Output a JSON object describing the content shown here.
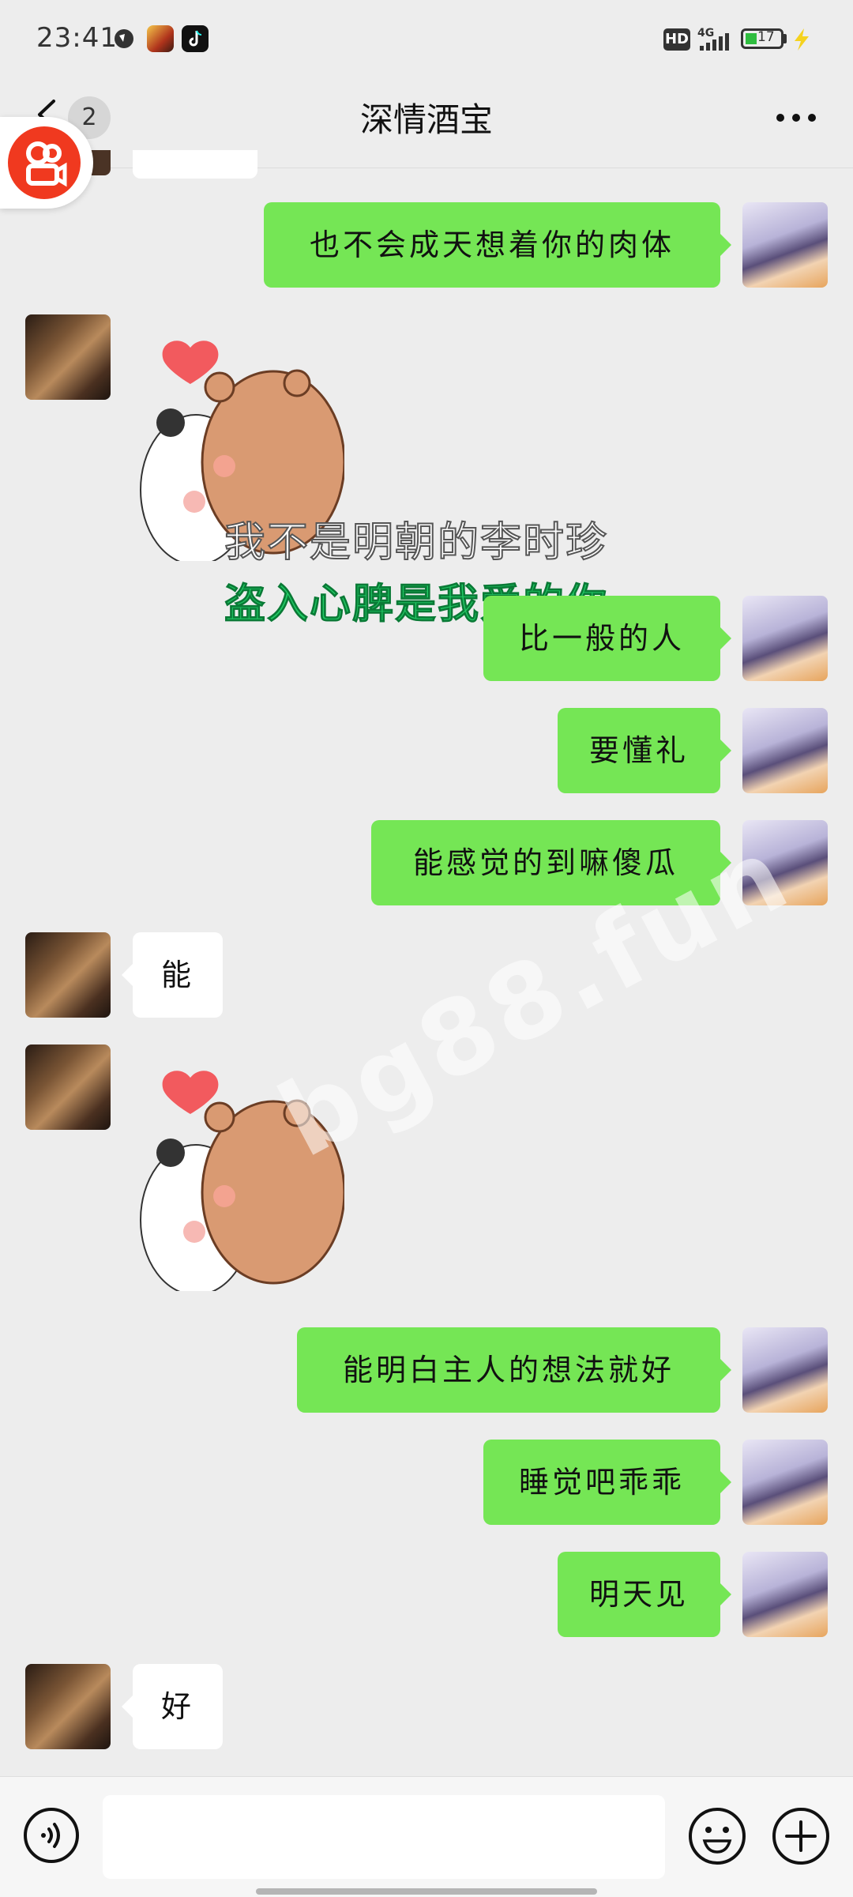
{
  "status_bar": {
    "time": "23:41",
    "network": "4G",
    "hd": "HD",
    "battery": "17"
  },
  "header": {
    "unread_count": "2",
    "title": "深情酒宝"
  },
  "messages": [
    {
      "side": "right",
      "text": "也不会成天想着你的肉体"
    },
    {
      "side": "left",
      "type": "sticker",
      "caption_line1": "我不是明朝的李时珍",
      "caption_line2": "盗入心脾是我爱的你"
    },
    {
      "side": "right",
      "text": "比一般的人"
    },
    {
      "side": "right",
      "text": "要懂礼"
    },
    {
      "side": "right",
      "text": "能感觉的到嘛傻瓜"
    },
    {
      "side": "left",
      "text": "能"
    },
    {
      "side": "left",
      "type": "sticker"
    },
    {
      "side": "right",
      "text": "能明白主人的想法就好"
    },
    {
      "side": "right",
      "text": "睡觉吧乖乖"
    },
    {
      "side": "right",
      "text": "明天见"
    },
    {
      "side": "left",
      "text": "好"
    }
  ],
  "watermark": "bg88.fun",
  "colors": {
    "sent_bubble": "#75e655",
    "background": "#ededed",
    "app_badge": "#f0391f"
  },
  "icons": {
    "voice": "voice-icon",
    "emoji": "emoji-icon",
    "plus": "plus-icon",
    "more": "more-icon",
    "back": "back-arrow-icon"
  }
}
